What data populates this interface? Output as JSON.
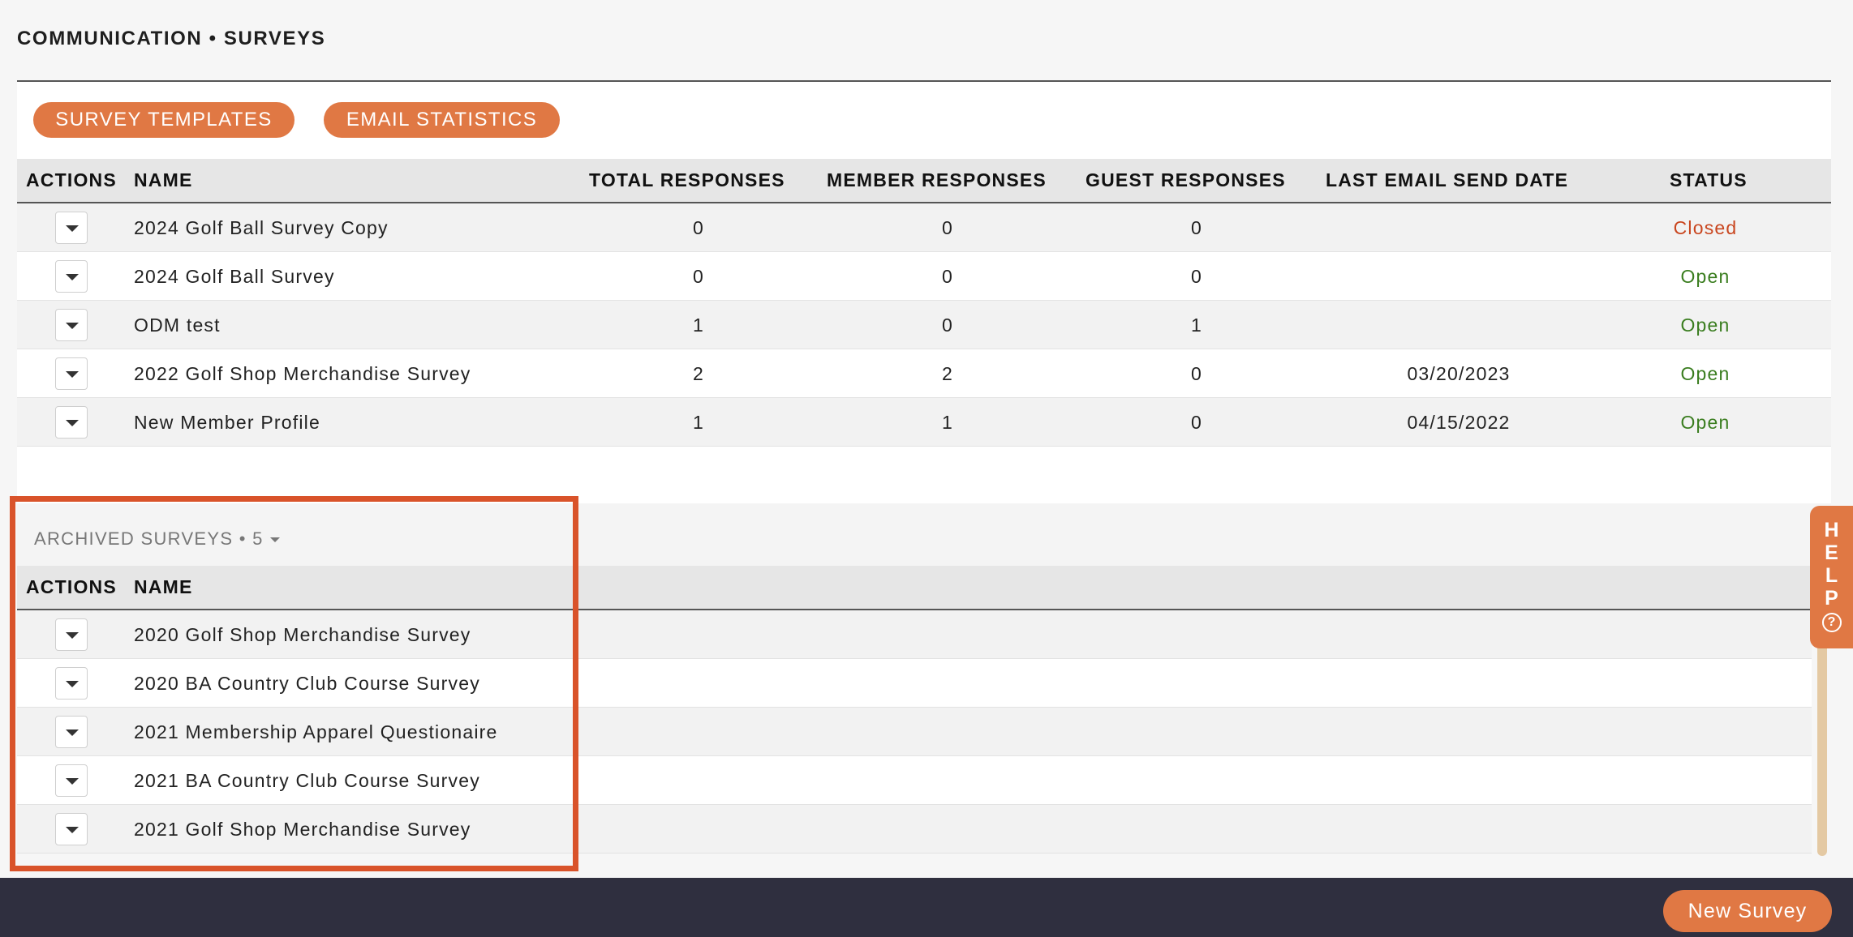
{
  "page": {
    "title": "COMMUNICATION • SURVEYS"
  },
  "toolbar": {
    "templates_label": "SURVEY TEMPLATES",
    "stats_label": "EMAIL STATISTICS"
  },
  "surveys": {
    "columns": {
      "actions": "ACTIONS",
      "name": "NAME",
      "total": "TOTAL RESPONSES",
      "member": "MEMBER RESPONSES",
      "guest": "GUEST RESPONSES",
      "last_email": "LAST EMAIL SEND DATE",
      "status": "STATUS"
    },
    "rows": [
      {
        "name": "2024 Golf Ball Survey Copy",
        "total": "0",
        "member": "0",
        "guest": "0",
        "last_email": "",
        "status": "Closed"
      },
      {
        "name": "2024 Golf Ball Survey",
        "total": "0",
        "member": "0",
        "guest": "0",
        "last_email": "",
        "status": "Open"
      },
      {
        "name": "ODM test",
        "total": "1",
        "member": "0",
        "guest": "1",
        "last_email": "",
        "status": "Open"
      },
      {
        "name": "2022 Golf Shop Merchandise Survey",
        "total": "2",
        "member": "2",
        "guest": "0",
        "last_email": "03/20/2023",
        "status": "Open"
      },
      {
        "name": "New Member Profile",
        "total": "1",
        "member": "1",
        "guest": "0",
        "last_email": "04/15/2022",
        "status": "Open"
      }
    ]
  },
  "archived": {
    "label": "ARCHIVED SURVEYS • 5",
    "columns": {
      "actions": "ACTIONS",
      "name": "NAME"
    },
    "rows": [
      {
        "name": "2020 Golf Shop Merchandise Survey"
      },
      {
        "name": "2020 BA Country Club Course Survey"
      },
      {
        "name": "2021 Membership Apparel Questionaire"
      },
      {
        "name": "2021 BA Country Club Course Survey"
      },
      {
        "name": "2021 Golf Shop Merchandise Survey"
      }
    ]
  },
  "help": {
    "letters": [
      "H",
      "E",
      "L",
      "P"
    ],
    "icon": "?"
  },
  "footer": {
    "new_survey_label": "New Survey"
  },
  "colors": {
    "accent": "#e07844",
    "highlight_border": "#d9532a",
    "status_open": "#3a7d1f",
    "status_closed": "#c9461f",
    "footer_bg": "#2f2f3f"
  }
}
